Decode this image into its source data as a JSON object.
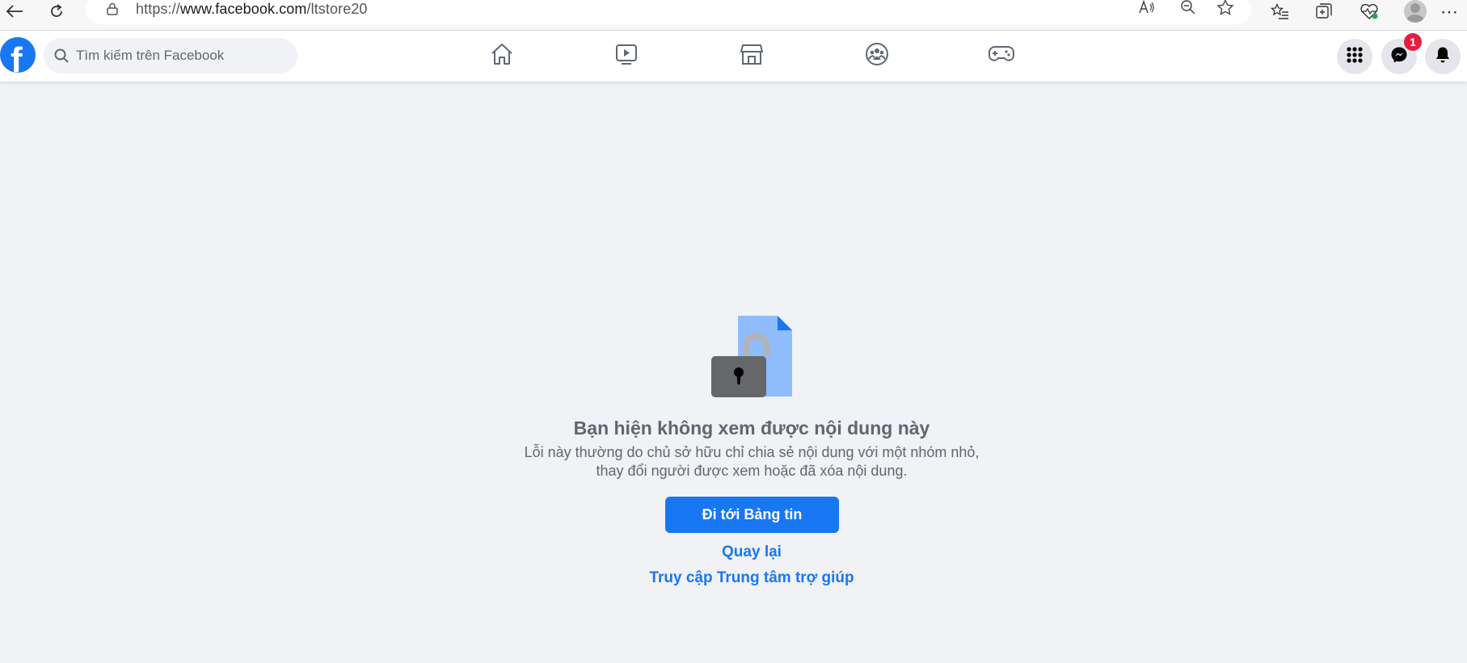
{
  "browser": {
    "url_scheme": "https://",
    "url_host": "www.facebook.com",
    "url_path": "/ltstore20"
  },
  "facebook": {
    "search_placeholder": "Tìm kiếm trên Facebook",
    "nav_tabs": [
      "home-icon",
      "video-icon",
      "marketplace-icon",
      "groups-icon",
      "gaming-icon"
    ],
    "messenger_badge": "1",
    "brand_color": "#1877f2"
  },
  "content": {
    "title": "Bạn hiện không xem được nội dung này",
    "body": "Lỗi này thường do chủ sở hữu chỉ chia sẻ nội dung với một nhóm nhỏ, thay đổi người được xem hoặc đã xóa nội dung.",
    "primary_button": "Đi tới Bảng tin",
    "back_link": "Quay lại",
    "help_link": "Truy cập Trung tâm trợ giúp"
  }
}
